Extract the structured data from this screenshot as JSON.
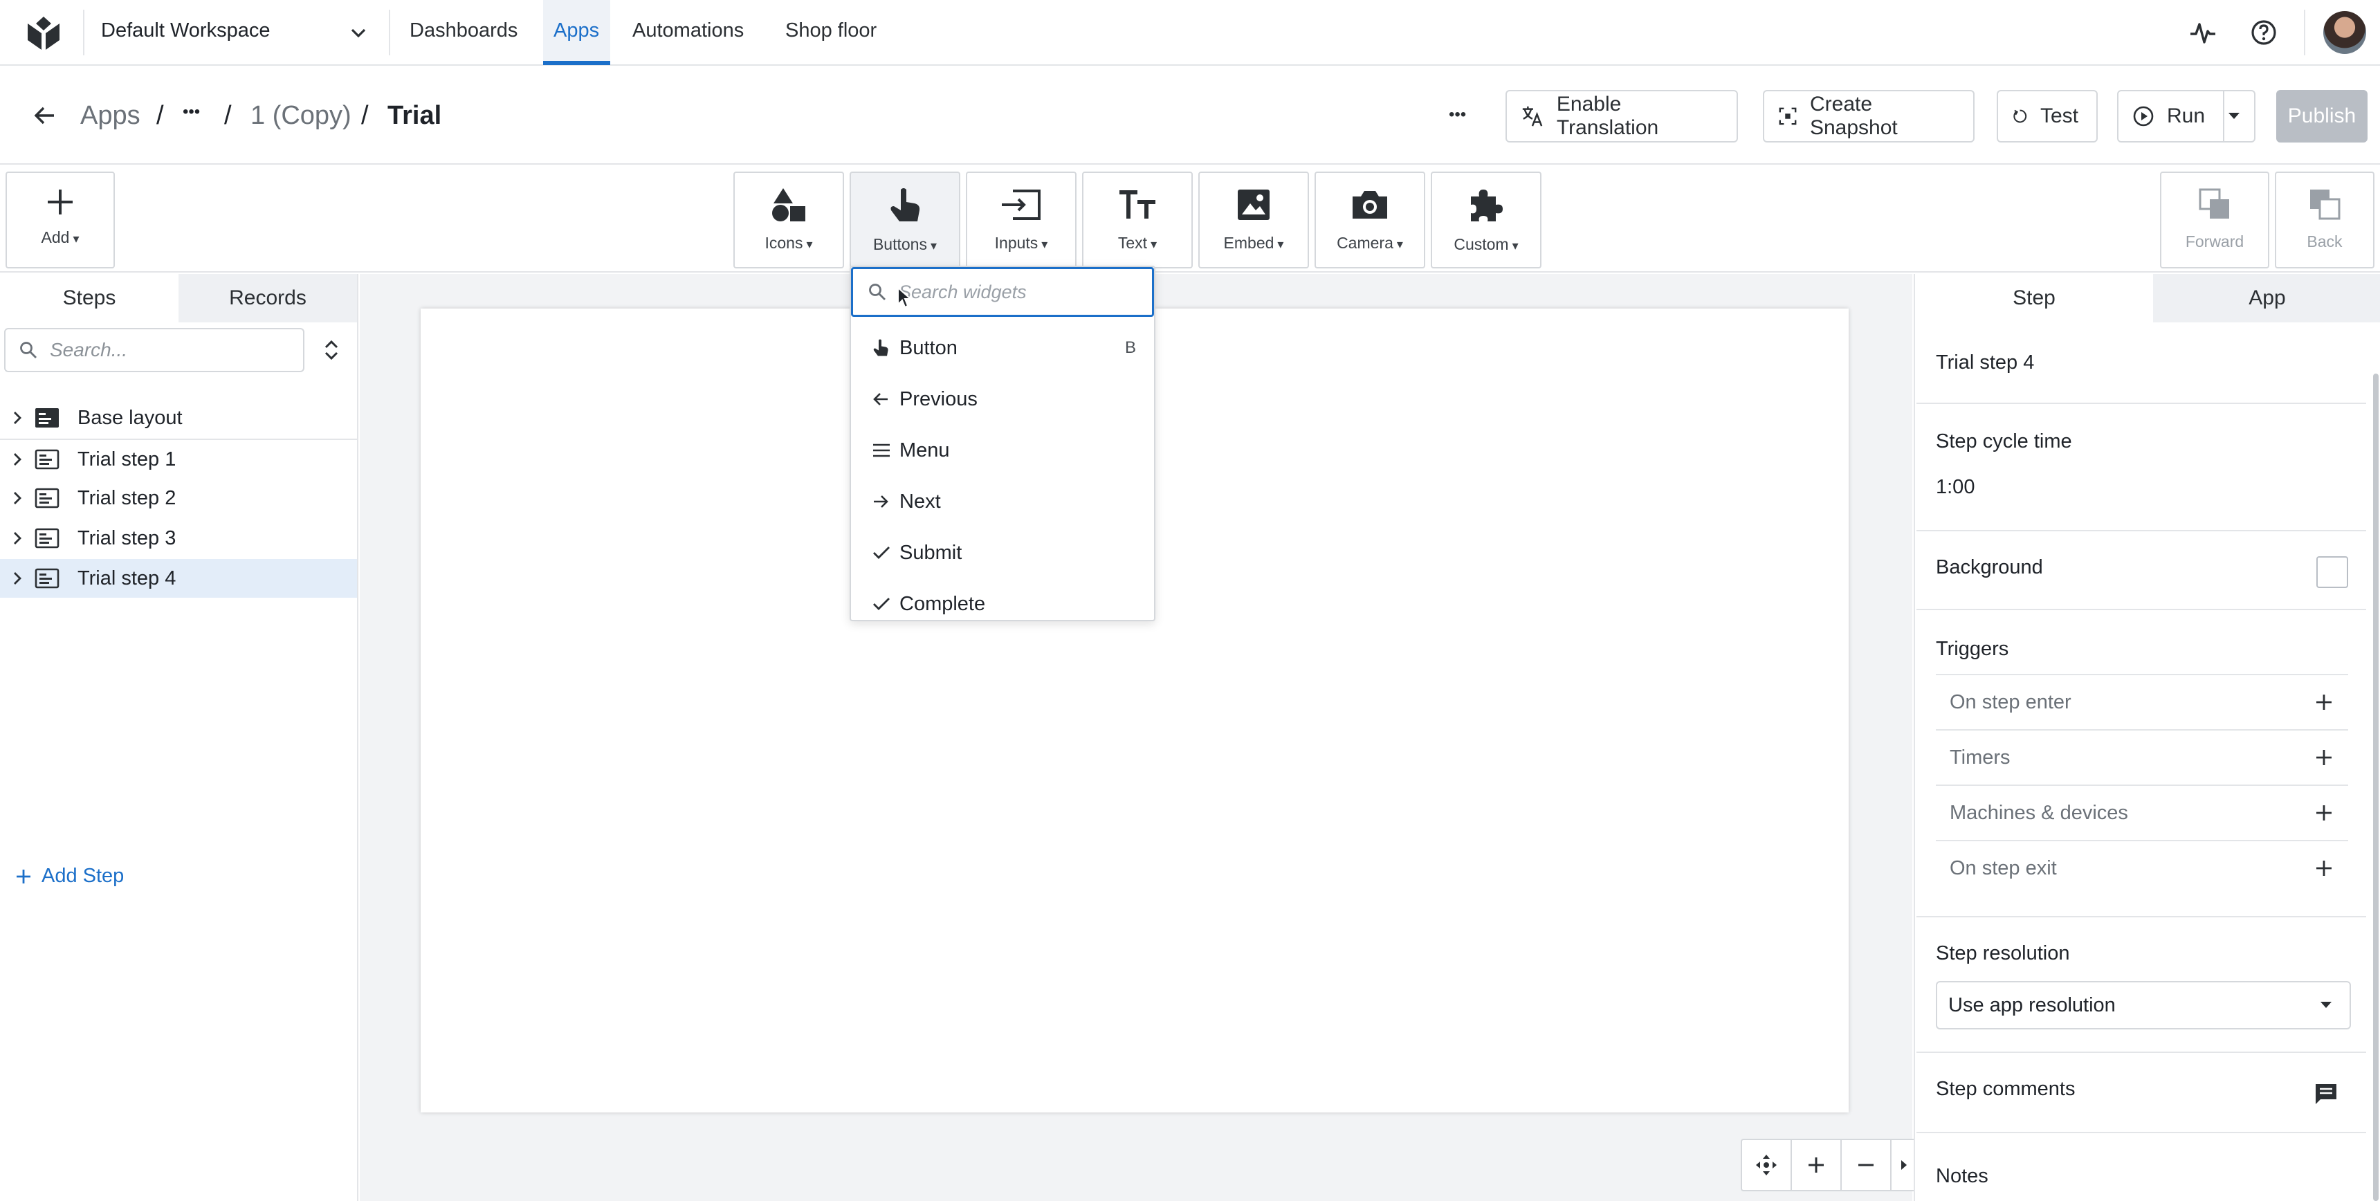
{
  "topnav": {
    "workspace": "Default Workspace",
    "links": [
      {
        "label": "Dashboards"
      },
      {
        "label": "Apps"
      },
      {
        "label": "Automations"
      },
      {
        "label": "Shop floor"
      }
    ],
    "active_link": "Apps"
  },
  "breadcrumb": {
    "root": "Apps",
    "ellipsis": "•••",
    "parent": "1 (Copy)",
    "current": "Trial",
    "separator": "/"
  },
  "header_actions": {
    "more": "•••",
    "enable_translation": "Enable Translation",
    "create_snapshot": "Create Snapshot",
    "test": "Test",
    "run": "Run",
    "publish": "Publish"
  },
  "toolbar": {
    "add": "Add",
    "widgets": [
      {
        "label": "Icons",
        "icon": "shapes-icon"
      },
      {
        "label": "Buttons",
        "icon": "pointer-hand-icon"
      },
      {
        "label": "Inputs",
        "icon": "input-icon"
      },
      {
        "label": "Text",
        "icon": "text-icon"
      },
      {
        "label": "Embed",
        "icon": "image-icon"
      },
      {
        "label": "Camera",
        "icon": "camera-icon"
      },
      {
        "label": "Custom",
        "icon": "puzzle-icon"
      }
    ],
    "forward": "Forward",
    "back": "Back"
  },
  "left_panel": {
    "tabs": [
      "Steps",
      "Records"
    ],
    "active_tab": "Steps",
    "search_placeholder": "Search...",
    "steps": [
      {
        "label": "Base layout",
        "kind": "layout"
      },
      {
        "label": "Trial step 1",
        "kind": "step"
      },
      {
        "label": "Trial step 2",
        "kind": "step"
      },
      {
        "label": "Trial step 3",
        "kind": "step"
      },
      {
        "label": "Trial step 4",
        "kind": "step",
        "selected": true
      }
    ],
    "add_step": "Add Step"
  },
  "dropdown": {
    "search_placeholder": "Search widgets",
    "items": [
      {
        "label": "Button",
        "icon": "pointer-hand-icon",
        "hotkey": "B"
      },
      {
        "label": "Previous",
        "icon": "arrow-left-icon",
        "hotkey": ""
      },
      {
        "label": "Menu",
        "icon": "menu-icon",
        "hotkey": ""
      },
      {
        "label": "Next",
        "icon": "arrow-right-icon",
        "hotkey": ""
      },
      {
        "label": "Submit",
        "icon": "check-icon",
        "hotkey": ""
      },
      {
        "label": "Complete",
        "icon": "check-icon",
        "hotkey": ""
      }
    ]
  },
  "right_panel": {
    "tabs": [
      "Step",
      "App"
    ],
    "active_tab": "Step",
    "step_name": "Trial step 4",
    "cycle_time_label": "Step cycle time",
    "cycle_time_value": "1:00",
    "background_label": "Background",
    "triggers_label": "Triggers",
    "triggers": [
      "On step enter",
      "Timers",
      "Machines & devices",
      "On step exit"
    ],
    "resolution_label": "Step resolution",
    "resolution_value": "Use app resolution",
    "comments_label": "Step comments",
    "notes_label": "Notes"
  },
  "colors": {
    "accent": "#1b6fc9",
    "selected_row": "#e3edf9",
    "border": "#d5d8dc",
    "publish_disabled": "#b9bec5"
  }
}
